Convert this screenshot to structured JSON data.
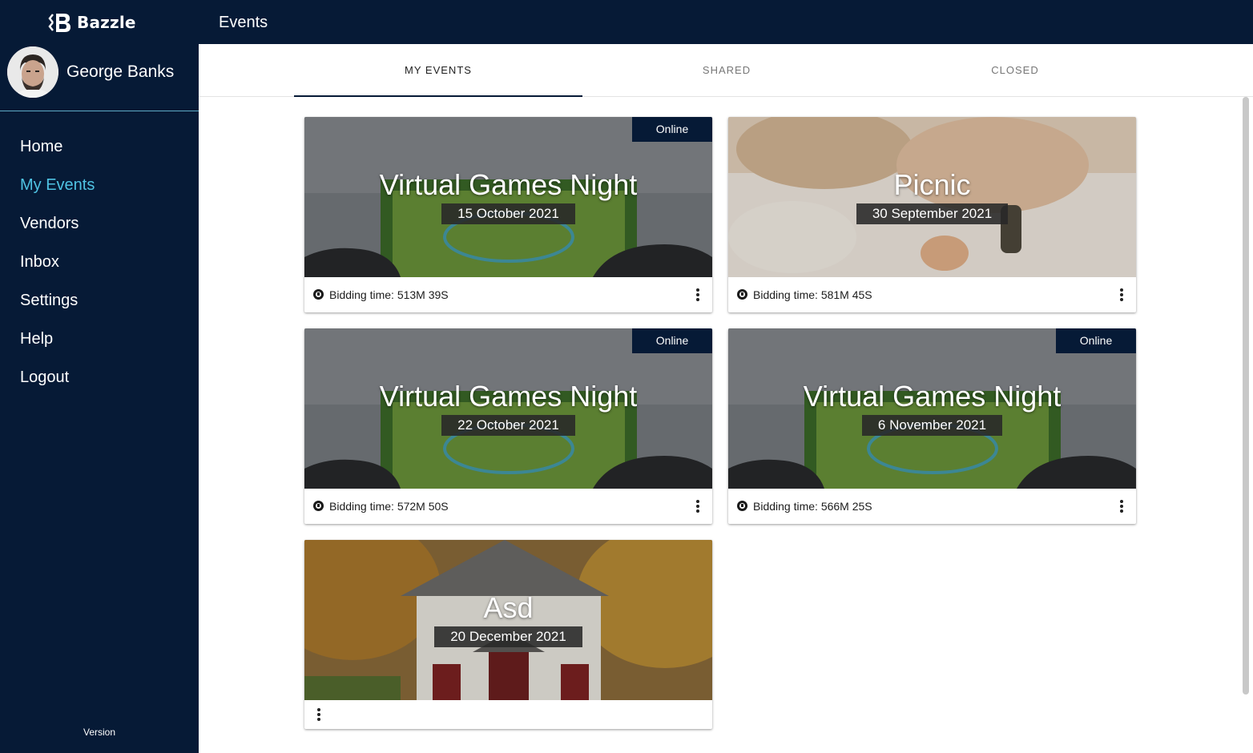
{
  "app": {
    "name": "Bazzle",
    "version_label": "Version"
  },
  "user": {
    "name": "George Banks"
  },
  "nav": [
    {
      "label": "Home",
      "active": false
    },
    {
      "label": "My Events",
      "active": true
    },
    {
      "label": "Vendors",
      "active": false
    },
    {
      "label": "Inbox",
      "active": false
    },
    {
      "label": "Settings",
      "active": false
    },
    {
      "label": "Help",
      "active": false
    },
    {
      "label": "Logout",
      "active": false
    }
  ],
  "header": {
    "title": "Events"
  },
  "tabs": [
    {
      "label": "MY EVENTS",
      "active": true
    },
    {
      "label": "SHARED",
      "active": false
    },
    {
      "label": "CLOSED",
      "active": false
    }
  ],
  "events": [
    {
      "title": "Virtual Games Night",
      "date": "15 October 2021",
      "badge": "Online",
      "bidding": "Bidding time: 513M 39S",
      "image": "gaming"
    },
    {
      "title": "Picnic",
      "date": "30 September 2021",
      "badge": "",
      "bidding": "Bidding time: 581M 45S",
      "image": "picnic"
    },
    {
      "title": "Virtual Games Night",
      "date": "22 October 2021",
      "badge": "Online",
      "bidding": "Bidding time: 572M 50S",
      "image": "gaming"
    },
    {
      "title": "Virtual Games Night",
      "date": "6 November 2021",
      "badge": "Online",
      "bidding": "Bidding time: 566M 25S",
      "image": "gaming"
    },
    {
      "title": "Asd",
      "date": "20 December 2021",
      "badge": "",
      "bidding": "",
      "image": "house"
    }
  ],
  "colors": {
    "navy": "#061a36",
    "accent": "#4fc3e3"
  },
  "icons": [
    "bazzle-logo-icon",
    "clock-icon",
    "more-vert-icon"
  ]
}
